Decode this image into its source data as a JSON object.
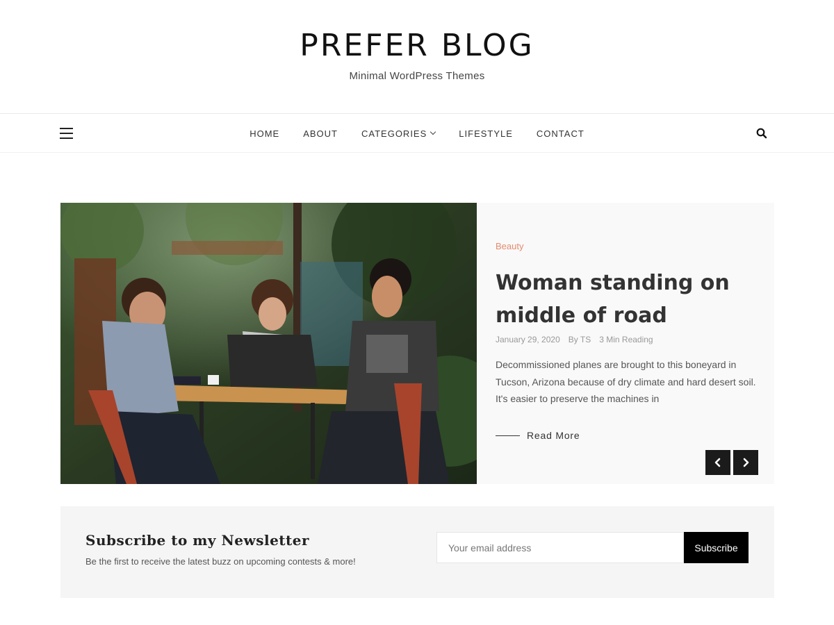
{
  "site": {
    "title": "PREFER BLOG",
    "tagline": "Minimal WordPress Themes"
  },
  "nav": {
    "items": [
      {
        "label": "HOME"
      },
      {
        "label": "ABOUT"
      },
      {
        "label": "CATEGORIES",
        "has_dropdown": true
      },
      {
        "label": "LIFESTYLE"
      },
      {
        "label": "CONTACT"
      }
    ],
    "menu_icon": "hamburger-icon",
    "search_icon": "search-icon"
  },
  "featured": {
    "category": "Beauty",
    "title": "Woman standing on middle of road",
    "date": "January 29, 2020",
    "author": "By TS",
    "reading_time": "3 Min Reading",
    "excerpt": "Decommissioned planes are brought to this boneyard in Tucson, Arizona because of dry climate and hard desert soil. It's easier to preserve the machines in",
    "read_more": "Read More",
    "prev_icon": "chevron-left-icon",
    "next_icon": "chevron-right-icon"
  },
  "newsletter": {
    "title": "Subscribe to my Newsletter",
    "subtitle": "Be the first to receive the latest buzz on upcoming contests & more!",
    "email_placeholder": "Your email address",
    "button_label": "Subscribe"
  },
  "colors": {
    "accent_category": "#e58b6e",
    "slider_button": "#1b1b1b",
    "newsletter_bg": "#f5f5f5",
    "subscribe_button": "#000000"
  }
}
